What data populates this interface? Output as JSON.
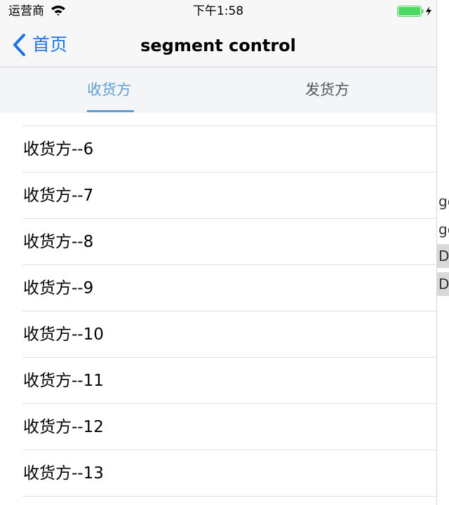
{
  "status_bar": {
    "carrier": "运营商",
    "time": "下午1:58",
    "battery_color": "#4cd964"
  },
  "nav": {
    "back_label": "首页",
    "title": "segment control",
    "accent_color": "#1a73e8"
  },
  "segment": {
    "tabs": [
      {
        "label": "收货方",
        "selected": true
      },
      {
        "label": "发货方",
        "selected": false
      }
    ],
    "active_color": "#5d9fd3"
  },
  "list": {
    "items": [
      {
        "label": "收货方--6"
      },
      {
        "label": "收货方--7"
      },
      {
        "label": "收货方--8"
      },
      {
        "label": "收货方--9"
      },
      {
        "label": "收货方--10"
      },
      {
        "label": "收货方--11"
      },
      {
        "label": "收货方--12"
      },
      {
        "label": "收货方--13"
      }
    ]
  },
  "background_window": {
    "rows": [
      {
        "text": "ge"
      },
      {
        "text": "ge"
      },
      {
        "text": "D"
      },
      {
        "text": "D"
      }
    ]
  }
}
